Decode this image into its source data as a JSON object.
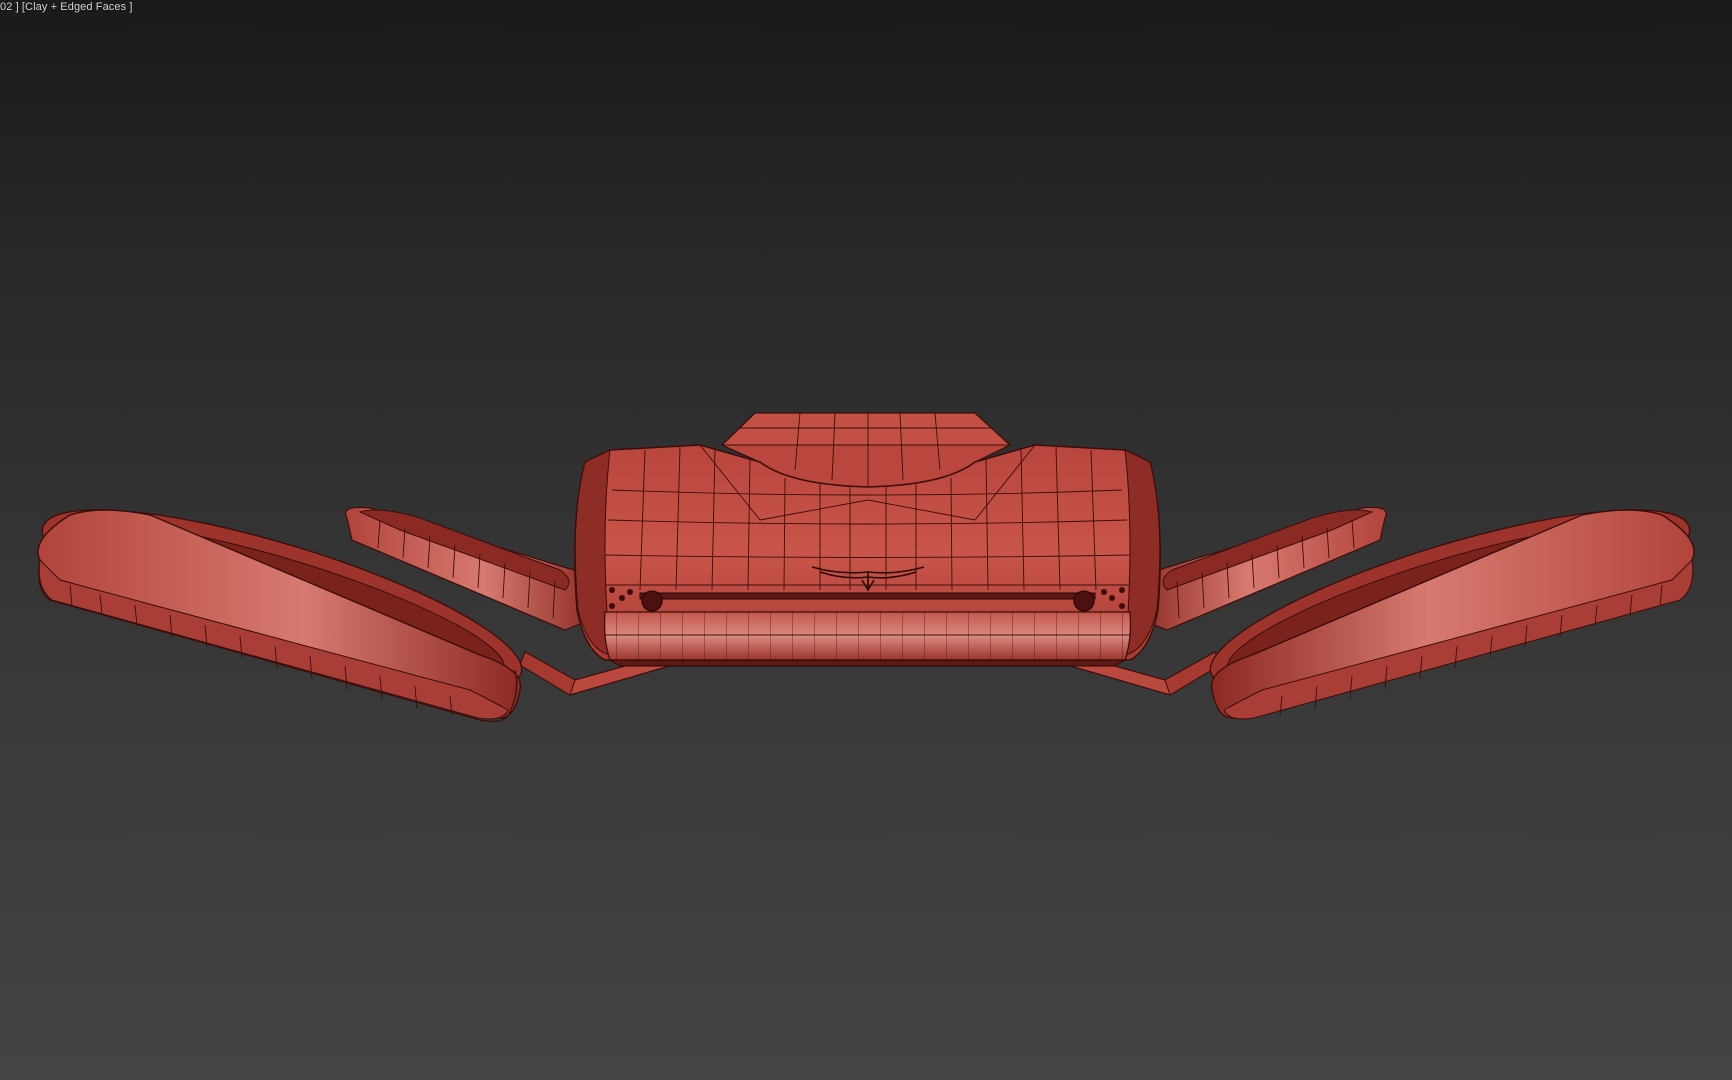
{
  "viewport": {
    "label": "02 ] [Clay + Edged Faces ]",
    "shading_mode": "Clay + Edged Faces",
    "object": "flying car drone model (front view, wireframe over clay)",
    "colors": {
      "background_top": "#1a1a1a",
      "background_bottom": "#444444",
      "clay": "#c4493f",
      "clay_light": "#d26257",
      "clay_dark": "#7a1f1a",
      "wire": "#3a0e0b"
    }
  }
}
